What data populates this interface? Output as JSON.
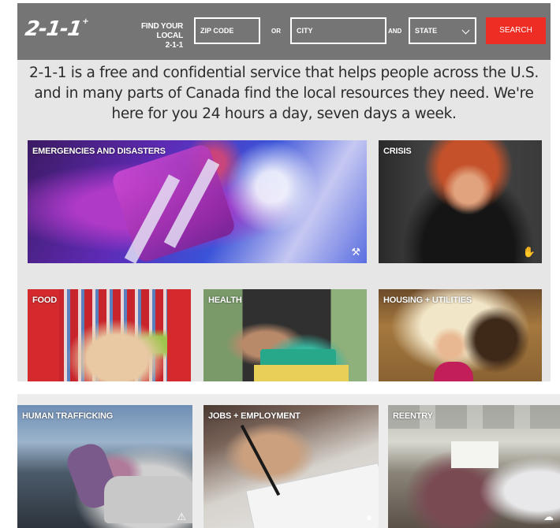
{
  "header": {
    "logo": "2-1-1",
    "logo_mark": "+",
    "find_label_line1": "FIND YOUR LOCAL",
    "find_label_line2": "2-1-1",
    "zip_placeholder": "ZIP CODE",
    "or_label": "OR",
    "city_placeholder": "CITY",
    "and_label": "AND",
    "state_value": "STATE",
    "search_label": "SEARCH"
  },
  "intro": "2-1-1 is a free and confidential service that helps people across the U.S. and in many parts of Canada find the local resources they need. We're here for you 24 hours a day, seven days a week.",
  "categories": [
    {
      "label": "EMERGENCIES AND DISASTERS",
      "icon": "tools-icon"
    },
    {
      "label": "CRISIS",
      "icon": "hand-icon"
    },
    {
      "label": "FOOD",
      "icon": ""
    },
    {
      "label": "HEALTH",
      "icon": ""
    },
    {
      "label": "HOUSING + UTILITIES",
      "icon": ""
    },
    {
      "label": "HUMAN TRAFFICKING",
      "icon": "warning-icon"
    },
    {
      "label": "JOBS + EMPLOYMENT",
      "icon": "piggy-bank-icon"
    },
    {
      "label": "REENTRY",
      "icon": "cloud-icon"
    }
  ],
  "colors": {
    "header_bg": "#757575",
    "search_button": "#ee2d24",
    "page_bg": "#e6e6e6"
  }
}
